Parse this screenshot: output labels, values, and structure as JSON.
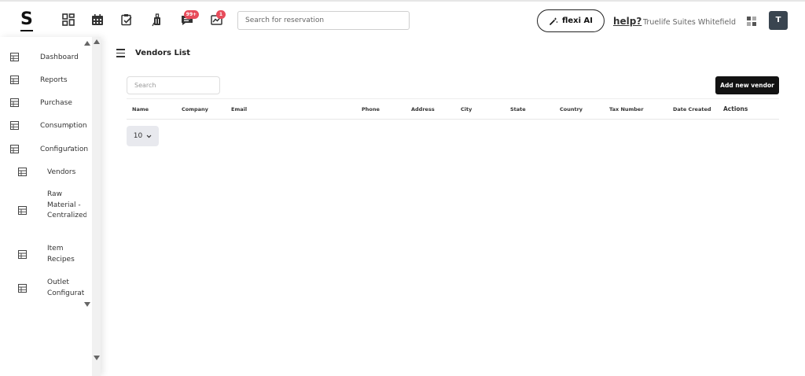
{
  "app": {
    "logo": "S",
    "notifications_badge": "99+",
    "messages_badge": "1",
    "search_placeholder": "Search for reservation",
    "flexi_label": "flexi AI",
    "help_label": "help?",
    "property_name": "Truelife Suites Whitefield",
    "avatar_initial": "T"
  },
  "icons": {
    "topbar": [
      "dashboard-grid-icon",
      "calendar-icon",
      "clipboard-check-icon",
      "luggage-icon",
      "chat-icon",
      "chart-message-icon"
    ],
    "flexi": "magic-wand-icon",
    "apps": "apps-grid-icon",
    "nav": "table-icon"
  },
  "sidebar": {
    "items": [
      {
        "label": "Dashboard"
      },
      {
        "label": "Reports"
      },
      {
        "label": "Purchase"
      },
      {
        "label": "Consumption"
      },
      {
        "label": "Configuration"
      }
    ],
    "subitems": [
      {
        "label": "Vendors"
      },
      {
        "label": "Raw Material - Centralized"
      },
      {
        "label": "Item Recipes"
      },
      {
        "label": "Outlet Configuration"
      }
    ]
  },
  "main": {
    "title": "Vendors List",
    "search_placeholder": "Search",
    "add_button": "Add new vendor",
    "columns": [
      "Name",
      "Company",
      "Email",
      "Phone",
      "Address",
      "City",
      "State",
      "Country",
      "Tax Number",
      "Date Created",
      "Actions"
    ],
    "page_size": "10"
  },
  "colors": {
    "accent_dark": "#121212",
    "badge": "#e74c5b",
    "avatar_bg": "#3a4550"
  }
}
